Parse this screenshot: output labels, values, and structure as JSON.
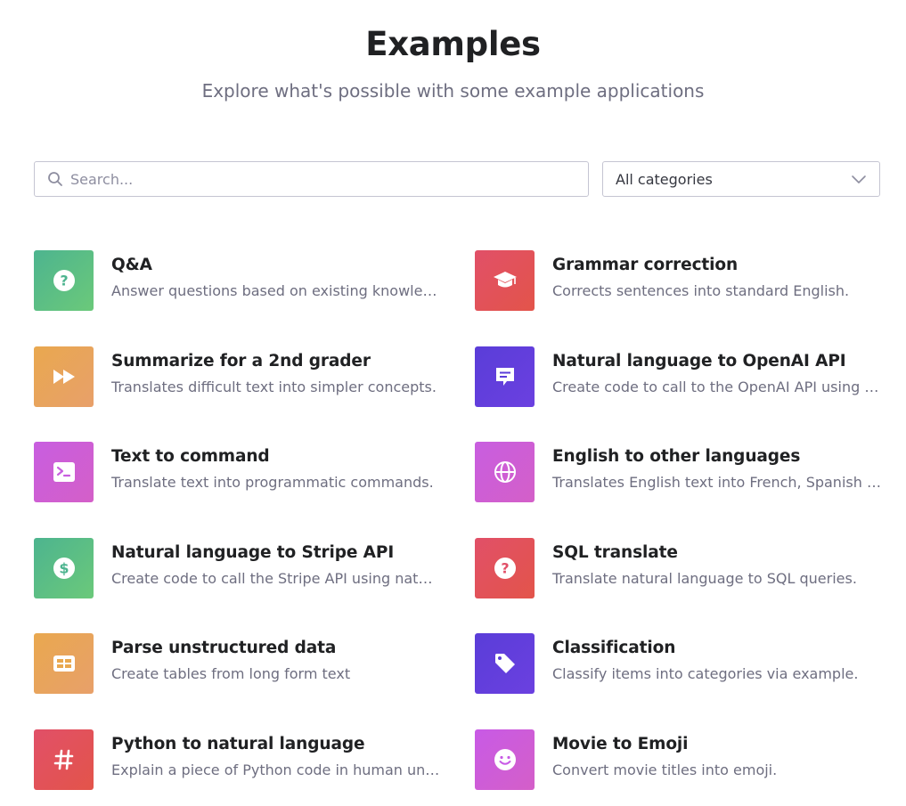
{
  "header": {
    "title": "Examples",
    "subtitle": "Explore what's possible with some example applications"
  },
  "search": {
    "icon": "search-icon",
    "placeholder": "Search..."
  },
  "category_select": {
    "value": "All categories",
    "icon": "chevron-down-icon"
  },
  "colors": {
    "title_text": "#202123",
    "muted_text": "#6e6e80",
    "border": "#c5c5d2"
  },
  "examples": [
    {
      "title": "Q&A",
      "description": "Answer questions based on existing knowledge.",
      "icon": "question-icon",
      "color": "#4db48f"
    },
    {
      "title": "Grammar correction",
      "description": "Corrects sentences into standard English.",
      "icon": "graduation-cap-icon",
      "color": "#e15068"
    },
    {
      "title": "Summarize for a 2nd grader",
      "description": "Translates difficult text into simpler concepts.",
      "icon": "fast-forward-icon",
      "color": "#e9a84f"
    },
    {
      "title": "Natural language to OpenAI API",
      "description": "Create code to call to the OpenAI API using a natural language instruction.",
      "icon": "chat-bubble-icon",
      "color": "#5a3dd8"
    },
    {
      "title": "Text to command",
      "description": "Translate text into programmatic commands.",
      "icon": "terminal-icon",
      "color": "#c85ee0"
    },
    {
      "title": "English to other languages",
      "description": "Translates English text into French, Spanish and Japanese.",
      "icon": "globe-icon",
      "color": "#c85ee0"
    },
    {
      "title": "Natural language to Stripe API",
      "description": "Create code to call the Stripe API using natural language.",
      "icon": "dollar-icon",
      "color": "#4db48f"
    },
    {
      "title": "SQL translate",
      "description": "Translate natural language to SQL queries.",
      "icon": "question-icon",
      "color": "#e15068"
    },
    {
      "title": "Parse unstructured data",
      "description": "Create tables from long form text",
      "icon": "table-icon",
      "color": "#e9a84f"
    },
    {
      "title": "Classification",
      "description": "Classify items into categories via example.",
      "icon": "tag-icon",
      "color": "#5a3dd8"
    },
    {
      "title": "Python to natural language",
      "description": "Explain a piece of Python code in human understandable language.",
      "icon": "hash-icon",
      "color": "#e15068"
    },
    {
      "title": "Movie to Emoji",
      "description": "Convert movie titles into emoji.",
      "icon": "smiley-icon",
      "color": "#c85ae6"
    }
  ]
}
